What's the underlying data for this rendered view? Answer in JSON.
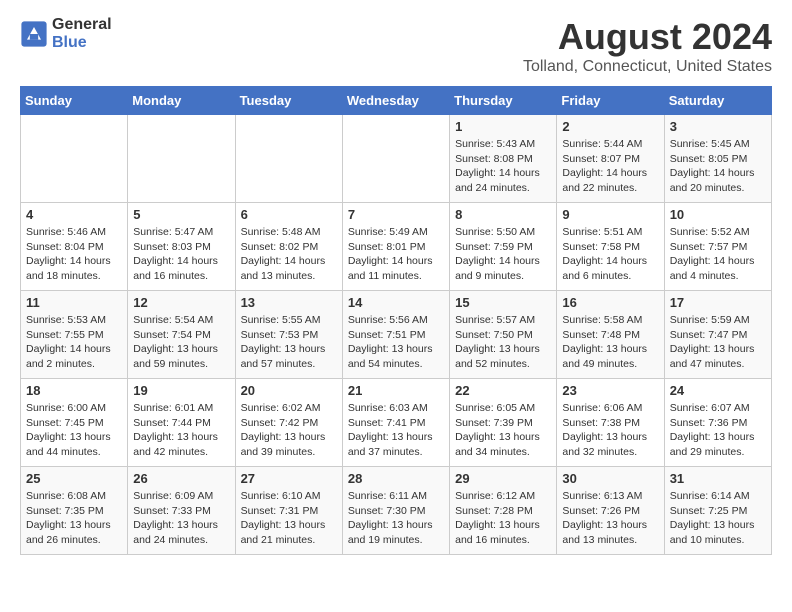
{
  "header": {
    "logo_line1": "General",
    "logo_line2": "Blue",
    "title": "August 2024",
    "subtitle": "Tolland, Connecticut, United States"
  },
  "days_of_week": [
    "Sunday",
    "Monday",
    "Tuesday",
    "Wednesday",
    "Thursday",
    "Friday",
    "Saturday"
  ],
  "weeks": [
    [
      {
        "day": "",
        "info": ""
      },
      {
        "day": "",
        "info": ""
      },
      {
        "day": "",
        "info": ""
      },
      {
        "day": "",
        "info": ""
      },
      {
        "day": "1",
        "info": "Sunrise: 5:43 AM\nSunset: 8:08 PM\nDaylight: 14 hours\nand 24 minutes."
      },
      {
        "day": "2",
        "info": "Sunrise: 5:44 AM\nSunset: 8:07 PM\nDaylight: 14 hours\nand 22 minutes."
      },
      {
        "day": "3",
        "info": "Sunrise: 5:45 AM\nSunset: 8:05 PM\nDaylight: 14 hours\nand 20 minutes."
      }
    ],
    [
      {
        "day": "4",
        "info": "Sunrise: 5:46 AM\nSunset: 8:04 PM\nDaylight: 14 hours\nand 18 minutes."
      },
      {
        "day": "5",
        "info": "Sunrise: 5:47 AM\nSunset: 8:03 PM\nDaylight: 14 hours\nand 16 minutes."
      },
      {
        "day": "6",
        "info": "Sunrise: 5:48 AM\nSunset: 8:02 PM\nDaylight: 14 hours\nand 13 minutes."
      },
      {
        "day": "7",
        "info": "Sunrise: 5:49 AM\nSunset: 8:01 PM\nDaylight: 14 hours\nand 11 minutes."
      },
      {
        "day": "8",
        "info": "Sunrise: 5:50 AM\nSunset: 7:59 PM\nDaylight: 14 hours\nand 9 minutes."
      },
      {
        "day": "9",
        "info": "Sunrise: 5:51 AM\nSunset: 7:58 PM\nDaylight: 14 hours\nand 6 minutes."
      },
      {
        "day": "10",
        "info": "Sunrise: 5:52 AM\nSunset: 7:57 PM\nDaylight: 14 hours\nand 4 minutes."
      }
    ],
    [
      {
        "day": "11",
        "info": "Sunrise: 5:53 AM\nSunset: 7:55 PM\nDaylight: 14 hours\nand 2 minutes."
      },
      {
        "day": "12",
        "info": "Sunrise: 5:54 AM\nSunset: 7:54 PM\nDaylight: 13 hours\nand 59 minutes."
      },
      {
        "day": "13",
        "info": "Sunrise: 5:55 AM\nSunset: 7:53 PM\nDaylight: 13 hours\nand 57 minutes."
      },
      {
        "day": "14",
        "info": "Sunrise: 5:56 AM\nSunset: 7:51 PM\nDaylight: 13 hours\nand 54 minutes."
      },
      {
        "day": "15",
        "info": "Sunrise: 5:57 AM\nSunset: 7:50 PM\nDaylight: 13 hours\nand 52 minutes."
      },
      {
        "day": "16",
        "info": "Sunrise: 5:58 AM\nSunset: 7:48 PM\nDaylight: 13 hours\nand 49 minutes."
      },
      {
        "day": "17",
        "info": "Sunrise: 5:59 AM\nSunset: 7:47 PM\nDaylight: 13 hours\nand 47 minutes."
      }
    ],
    [
      {
        "day": "18",
        "info": "Sunrise: 6:00 AM\nSunset: 7:45 PM\nDaylight: 13 hours\nand 44 minutes."
      },
      {
        "day": "19",
        "info": "Sunrise: 6:01 AM\nSunset: 7:44 PM\nDaylight: 13 hours\nand 42 minutes."
      },
      {
        "day": "20",
        "info": "Sunrise: 6:02 AM\nSunset: 7:42 PM\nDaylight: 13 hours\nand 39 minutes."
      },
      {
        "day": "21",
        "info": "Sunrise: 6:03 AM\nSunset: 7:41 PM\nDaylight: 13 hours\nand 37 minutes."
      },
      {
        "day": "22",
        "info": "Sunrise: 6:05 AM\nSunset: 7:39 PM\nDaylight: 13 hours\nand 34 minutes."
      },
      {
        "day": "23",
        "info": "Sunrise: 6:06 AM\nSunset: 7:38 PM\nDaylight: 13 hours\nand 32 minutes."
      },
      {
        "day": "24",
        "info": "Sunrise: 6:07 AM\nSunset: 7:36 PM\nDaylight: 13 hours\nand 29 minutes."
      }
    ],
    [
      {
        "day": "25",
        "info": "Sunrise: 6:08 AM\nSunset: 7:35 PM\nDaylight: 13 hours\nand 26 minutes."
      },
      {
        "day": "26",
        "info": "Sunrise: 6:09 AM\nSunset: 7:33 PM\nDaylight: 13 hours\nand 24 minutes."
      },
      {
        "day": "27",
        "info": "Sunrise: 6:10 AM\nSunset: 7:31 PM\nDaylight: 13 hours\nand 21 minutes."
      },
      {
        "day": "28",
        "info": "Sunrise: 6:11 AM\nSunset: 7:30 PM\nDaylight: 13 hours\nand 19 minutes."
      },
      {
        "day": "29",
        "info": "Sunrise: 6:12 AM\nSunset: 7:28 PM\nDaylight: 13 hours\nand 16 minutes."
      },
      {
        "day": "30",
        "info": "Sunrise: 6:13 AM\nSunset: 7:26 PM\nDaylight: 13 hours\nand 13 minutes."
      },
      {
        "day": "31",
        "info": "Sunrise: 6:14 AM\nSunset: 7:25 PM\nDaylight: 13 hours\nand 10 minutes."
      }
    ]
  ]
}
